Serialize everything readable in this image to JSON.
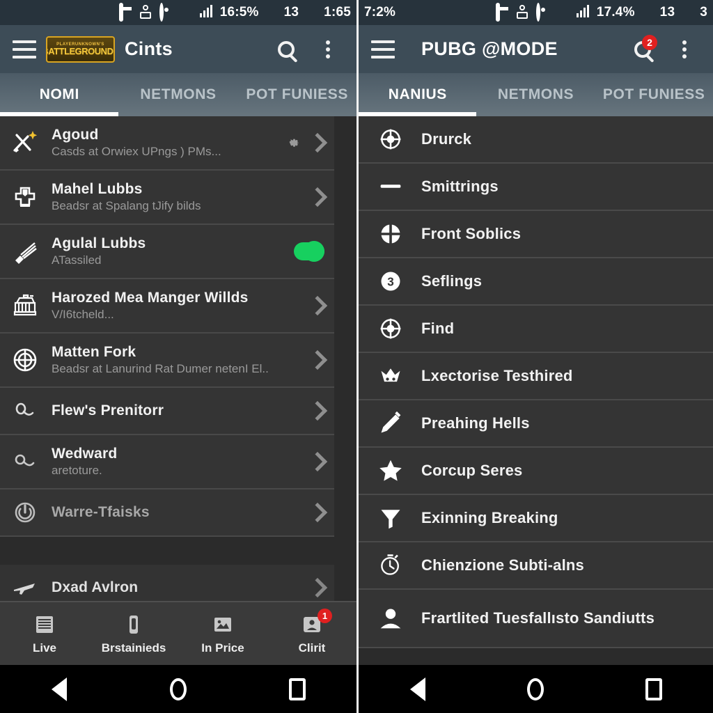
{
  "left": {
    "statusbar": {
      "battery_pct": "16:5%",
      "count": "13",
      "clock": "1:65"
    },
    "appbar": {
      "logo_top": "PLAYERUNKNOWN'S",
      "logo_main": "BATTLEGROUNDS",
      "title": "Cints",
      "menu_icon": "hamburger-icon",
      "search_icon": "search-icon",
      "overflow_icon": "more-vertical-icon"
    },
    "tabs": [
      {
        "label": "NOMI",
        "active": true
      },
      {
        "label": "NETMONS",
        "active": false
      },
      {
        "label": "POT FUNIESS",
        "active": false
      }
    ],
    "items": [
      {
        "title": "Agoud",
        "sub": "Casds at Orwiex UPngs ) PMs...",
        "icon": "crossed-tools-sparkle-icon",
        "gear": true,
        "chevron": true,
        "toggle": false
      },
      {
        "title": "Mahel Lubbs",
        "sub": "Beadsr at Spalang tJify bilds",
        "icon": "shield-armor-icon",
        "gear": false,
        "chevron": true,
        "toggle": false
      },
      {
        "title": "Agulal Lubbs",
        "sub": "ATassiled",
        "icon": "brush-icon",
        "gear": false,
        "chevron": false,
        "toggle": true
      },
      {
        "title": "Harozed Mea Manger Willds",
        "sub": "V/I6tcheld...",
        "icon": "crate-icon",
        "gear": false,
        "chevron": true,
        "toggle": false
      },
      {
        "title": "Matten Fork",
        "sub": "Beadsr at Lanurind Rat Dumer netenI El..",
        "icon": "crosshair-circle-icon",
        "gear": false,
        "chevron": true,
        "toggle": false
      },
      {
        "title": "Flew's Prenitorr",
        "sub": "",
        "icon": "key-icon",
        "gear": false,
        "chevron": true,
        "toggle": false
      },
      {
        "title": "Wedward",
        "sub": "aretoture.",
        "icon": "key-round-icon",
        "gear": false,
        "chevron": true,
        "toggle": false
      },
      {
        "title": "Warre-Tfaisks",
        "sub": "",
        "icon": "power-icon",
        "gear": false,
        "chevron": true,
        "toggle": false,
        "dim": true
      }
    ],
    "partial_item": {
      "title": "Dxad Avlron",
      "icon": "airplane-icon"
    },
    "bottomnav": [
      {
        "label": "Live",
        "icon": "list-lines-icon",
        "badge": ""
      },
      {
        "label": "Brstainieds",
        "icon": "device-icon",
        "badge": ""
      },
      {
        "label": "In Price",
        "icon": "image-icon",
        "badge": ""
      },
      {
        "label": "Clirit",
        "icon": "contact-card-icon",
        "badge": "1"
      }
    ]
  },
  "right": {
    "statusbar": {
      "left_pct": "7:2%",
      "battery_pct": "17.4%",
      "count": "13",
      "clock": "3"
    },
    "appbar": {
      "title": "PUBG @MODE",
      "menu_icon": "hamburger-icon",
      "search_icon": "search-icon",
      "search_badge": "2",
      "overflow_icon": "more-vertical-icon"
    },
    "tabs": [
      {
        "label": "NANIUS",
        "active": true
      },
      {
        "label": "NETMONS",
        "active": false
      },
      {
        "label": "POT FUNIESS",
        "active": false
      }
    ],
    "items": [
      {
        "title": "Drurck",
        "icon": "crosshair-circle-icon"
      },
      {
        "title": "Smittrings",
        "icon": "dash-line-icon"
      },
      {
        "title": "Front Soblics",
        "icon": "crosshair-filled-icon"
      },
      {
        "title": "Seflings",
        "icon": "number-three-circle-icon"
      },
      {
        "title": "Find",
        "icon": "crosshair-circle-icon"
      },
      {
        "title": "Lxectorise Testhired",
        "icon": "crown-icon"
      },
      {
        "title": "Preahing Hells",
        "icon": "pen-icon"
      },
      {
        "title": "Corcup Seres",
        "icon": "star-icon"
      },
      {
        "title": "Exinning Breaking",
        "icon": "funnel-icon"
      },
      {
        "title": "Chienzione Subti-alns",
        "icon": "stopwatch-icon"
      },
      {
        "title": "Frartlited Tuesfallısto Sandiutts",
        "icon": "person-icon",
        "wrap": true
      }
    ]
  },
  "androidnav": {
    "back": "back-triangle-icon",
    "home": "home-circle-icon",
    "recents": "recents-square-icon"
  },
  "colors": {
    "statusbar_bg": "#27333c",
    "appbar_bg": "#3d4c57",
    "tab_active": "#ffffff",
    "toggle_on": "#17d05f",
    "badge_red": "#e02020",
    "logo_gold": "#f5c93c"
  }
}
